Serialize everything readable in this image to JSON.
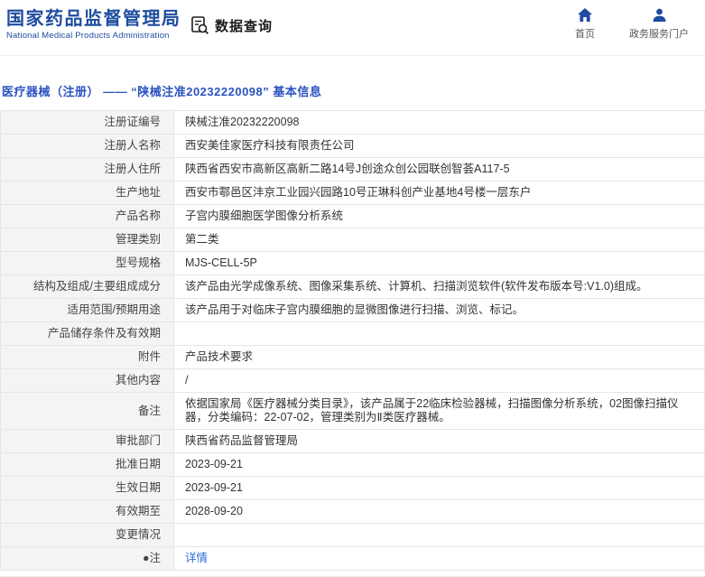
{
  "header": {
    "org_name_cn": "国家药品监督管理局",
    "org_name_en": "National Medical Products Administration",
    "section_title": "数据查询",
    "nav_home": "首页",
    "nav_portal": "政务服务门户"
  },
  "page": {
    "title": "医疗器械（注册） —— “陕械注准20232220098” 基本信息"
  },
  "table": {
    "rows": [
      {
        "label": "注册证编号",
        "value": "陕械注准20232220098"
      },
      {
        "label": "注册人名称",
        "value": "西安美佳家医疗科技有限责任公司"
      },
      {
        "label": "注册人住所",
        "value": "陕西省西安市高新区高新二路14号J创途众创公园联创智荟A117-5"
      },
      {
        "label": "生产地址",
        "value": "西安市鄠邑区沣京工业园兴园路10号正琳科创产业基地4号楼一层东户"
      },
      {
        "label": "产品名称",
        "value": "子宫内膜细胞医学图像分析系统"
      },
      {
        "label": "管理类别",
        "value": "第二类"
      },
      {
        "label": "型号规格",
        "value": "MJS-CELL-5P"
      },
      {
        "label": "结构及组成/主要组成成分",
        "value": "该产品由光学成像系统、图像采集系统、计算机、扫描浏览软件(软件发布版本号:V1.0)组成。"
      },
      {
        "label": "适用范围/预期用途",
        "value": "该产品用于对临床子宫内膜细胞的显微图像进行扫描、浏览、标记。"
      },
      {
        "label": "产品储存条件及有效期",
        "value": ""
      },
      {
        "label": "附件",
        "value": "产品技术要求"
      },
      {
        "label": "其他内容",
        "value": "/"
      },
      {
        "label": "备注",
        "value": "依据国家局《医疗器械分类目录》，该产品属于22临床检验器械，扫描图像分析系统，02图像扫描仪器，分类编码：22-07-02，管理类别为Ⅱ类医疗器械。"
      },
      {
        "label": "审批部门",
        "value": "陕西省药品监督管理局"
      },
      {
        "label": "批准日期",
        "value": "2023-09-21"
      },
      {
        "label": "生效日期",
        "value": "2023-09-21"
      },
      {
        "label": "有效期至",
        "value": "2028-09-20"
      },
      {
        "label": "变更情况",
        "value": ""
      },
      {
        "label": "●注",
        "value": "详情",
        "link": true
      }
    ]
  },
  "colors": {
    "brand_blue": "#1e4ca0",
    "link_blue": "#2f6bd8",
    "label_bg": "#f4f4f4"
  }
}
